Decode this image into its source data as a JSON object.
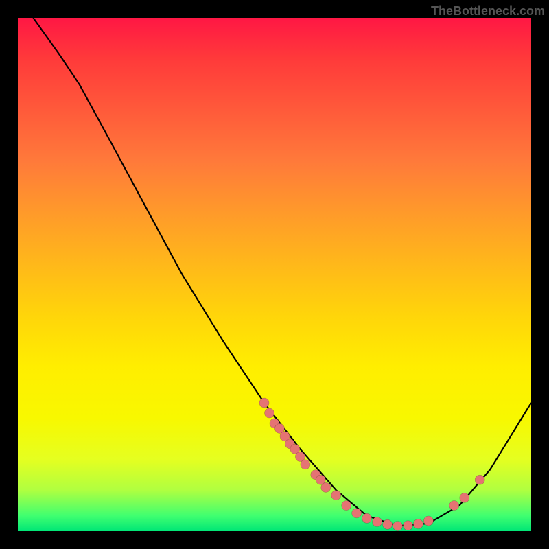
{
  "watermark": "TheBottleneck.com",
  "chart_data": {
    "type": "line",
    "title": "",
    "xlabel": "",
    "ylabel": "",
    "xlim": [
      0,
      100
    ],
    "ylim": [
      0,
      100
    ],
    "curve": [
      {
        "x": 3,
        "y": 100
      },
      {
        "x": 8,
        "y": 93
      },
      {
        "x": 12,
        "y": 87
      },
      {
        "x": 18,
        "y": 76
      },
      {
        "x": 25,
        "y": 63
      },
      {
        "x": 32,
        "y": 50
      },
      {
        "x": 40,
        "y": 37
      },
      {
        "x": 48,
        "y": 25
      },
      {
        "x": 55,
        "y": 16
      },
      {
        "x": 62,
        "y": 8
      },
      {
        "x": 68,
        "y": 3
      },
      {
        "x": 74,
        "y": 1
      },
      {
        "x": 80,
        "y": 1.5
      },
      {
        "x": 86,
        "y": 5
      },
      {
        "x": 92,
        "y": 12
      },
      {
        "x": 100,
        "y": 25
      }
    ],
    "points": [
      {
        "x": 48,
        "y": 25
      },
      {
        "x": 49,
        "y": 23
      },
      {
        "x": 50,
        "y": 21
      },
      {
        "x": 51,
        "y": 20
      },
      {
        "x": 52,
        "y": 18.5
      },
      {
        "x": 53,
        "y": 17
      },
      {
        "x": 54,
        "y": 16
      },
      {
        "x": 55,
        "y": 14.5
      },
      {
        "x": 56,
        "y": 13
      },
      {
        "x": 58,
        "y": 11
      },
      {
        "x": 59,
        "y": 10
      },
      {
        "x": 60,
        "y": 8.5
      },
      {
        "x": 62,
        "y": 7
      },
      {
        "x": 64,
        "y": 5
      },
      {
        "x": 66,
        "y": 3.5
      },
      {
        "x": 68,
        "y": 2.5
      },
      {
        "x": 70,
        "y": 1.8
      },
      {
        "x": 72,
        "y": 1.3
      },
      {
        "x": 74,
        "y": 1.0
      },
      {
        "x": 76,
        "y": 1.1
      },
      {
        "x": 78,
        "y": 1.4
      },
      {
        "x": 80,
        "y": 2.0
      },
      {
        "x": 85,
        "y": 5.0
      },
      {
        "x": 87,
        "y": 6.5
      },
      {
        "x": 90,
        "y": 10.0
      }
    ],
    "point_radius": 7
  }
}
